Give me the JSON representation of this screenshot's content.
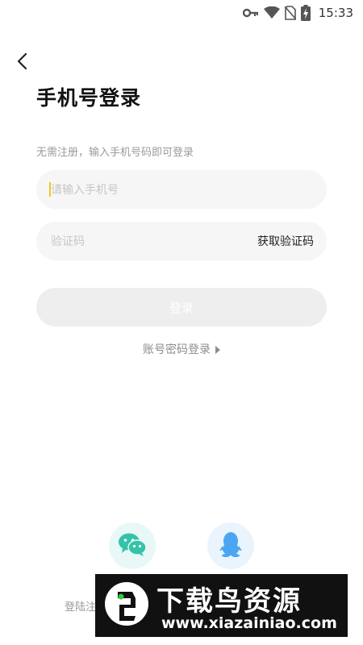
{
  "status_bar": {
    "time": "15:33"
  },
  "header": {
    "title": "手机号登录",
    "hint": "无需注册，输入手机号码即可登录"
  },
  "form": {
    "phone_placeholder": "请输入手机号",
    "code_placeholder": "验证码",
    "get_code_label": "获取验证码",
    "login_label": "登录",
    "password_login_label": "账号密码登录"
  },
  "social": {
    "agreement_text": "登陆注"
  },
  "watermark": {
    "title": "下载鸟资源",
    "url": "www.xiazainiao.com"
  },
  "colors": {
    "caret": "#f5c518",
    "wechat": "#33c3a8",
    "qq": "#4aa6f3",
    "button_disabled": "#eeeeee"
  }
}
